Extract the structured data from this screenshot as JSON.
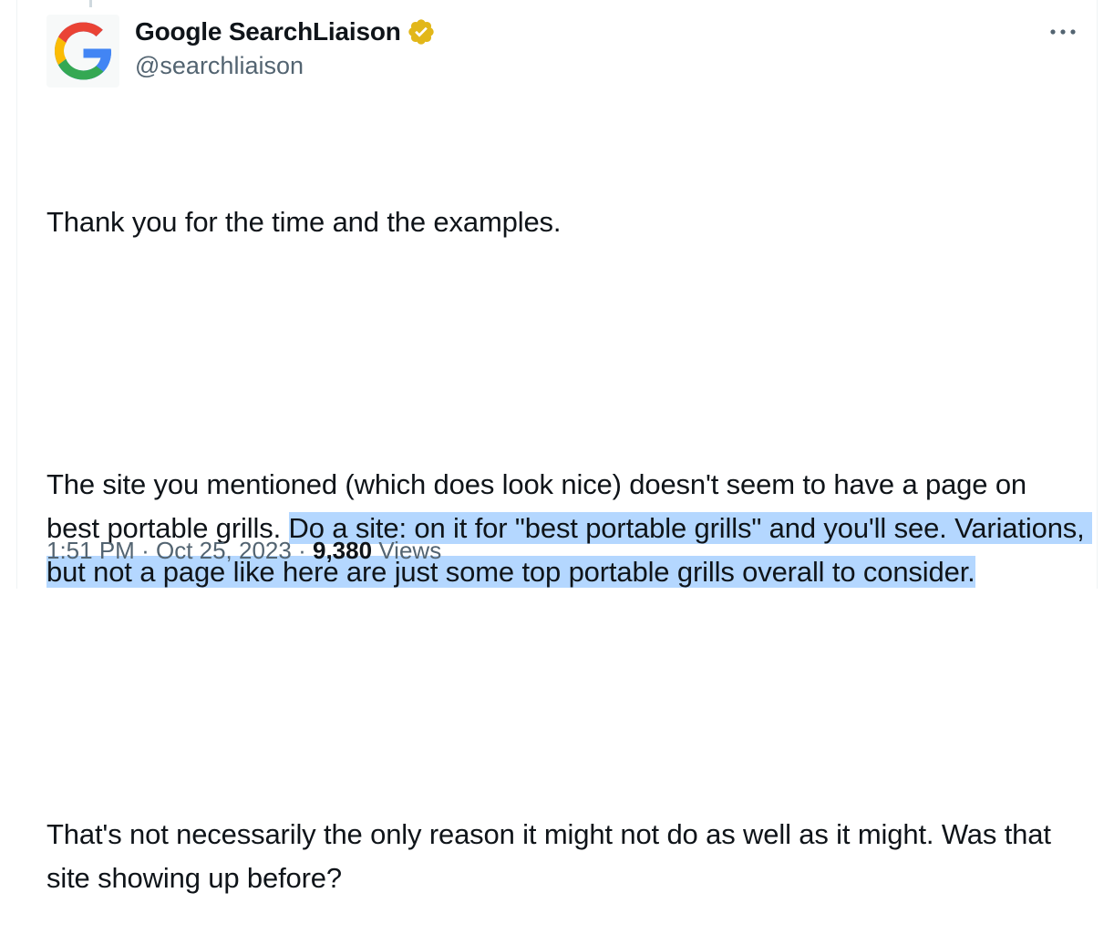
{
  "author": {
    "display_name": "Google SearchLiaison",
    "handle": "@searchliaison",
    "verified": true,
    "verified_color": "#E2B719",
    "avatar_icon": "google-g-logo"
  },
  "more_icon": "more-horizontal-icon",
  "tweet": {
    "line1": "Thank you for the time and the examples.",
    "para2_plain": "The site you mentioned (which does look nice) doesn't seem to have a page on best portable grills. ",
    "para2_highlighted": "Do a site: on it for \"best portable grills\" and you'll see. Variations, but not a page like here are just some top portable grills overall to consider.",
    "para3": "That's not necessarily the only reason it might not do as well as it might. Was that site showing up before?",
    "highlight_color": "#B4D7FF"
  },
  "meta": {
    "time": "1:51 PM",
    "separator": "·",
    "date": "Oct 25, 2023",
    "views_count": "9,380",
    "views_label": "Views"
  }
}
